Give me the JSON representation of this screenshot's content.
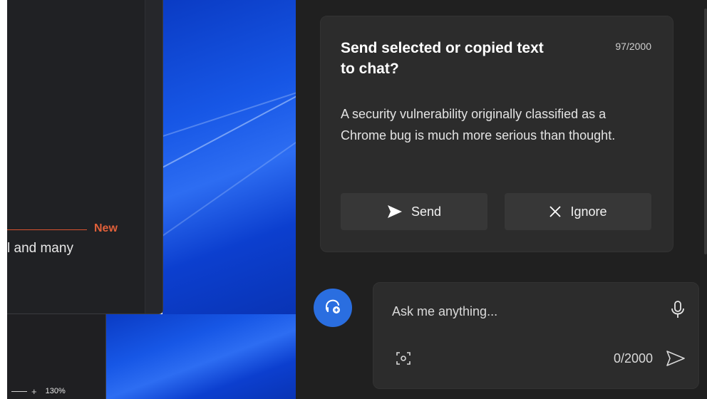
{
  "doc": {
    "new_label": "New",
    "text_fragment": "l and many"
  },
  "zoom": {
    "plus": "+",
    "level": "130%"
  },
  "prompt_card": {
    "title": "Send selected or copied text to chat?",
    "count": "97/2000",
    "body": "A security vulnerability originally classified as a Chrome bug is much more serious than thought.",
    "send_label": "Send",
    "ignore_label": "Ignore"
  },
  "chat_input": {
    "placeholder": "Ask me anything...",
    "count": "0/2000"
  },
  "icons": [
    "send-icon",
    "close-icon",
    "copilot-new-topic-icon",
    "microphone-icon",
    "screenshot-icon",
    "send-arrow-icon"
  ],
  "colors": {
    "accent": "#2a6ee0",
    "new_label": "#e0603a",
    "panel_bg": "#202020",
    "card_bg": "#2c2c2c"
  }
}
